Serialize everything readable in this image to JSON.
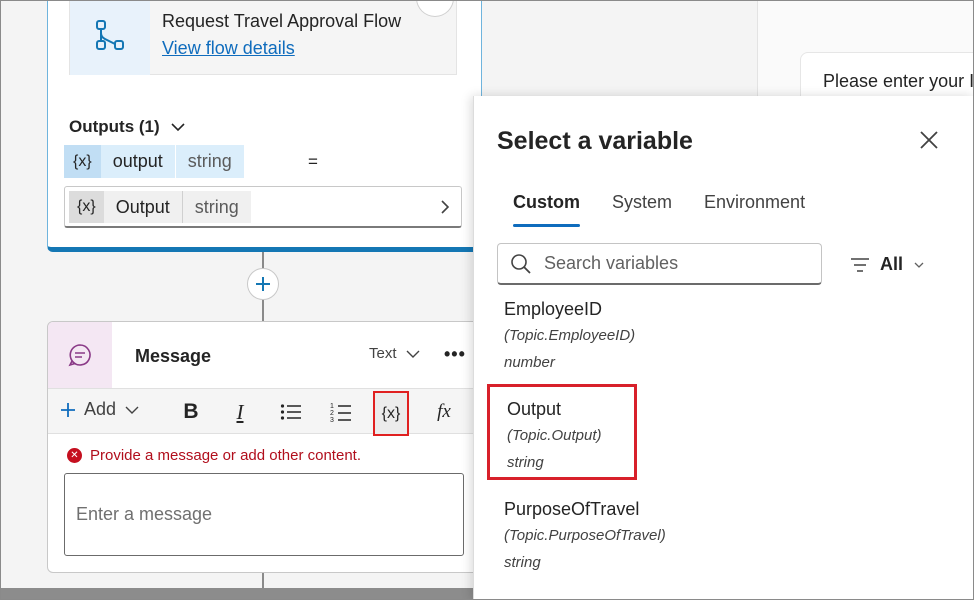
{
  "flow": {
    "title": "Request Travel Approval Flow",
    "link": "View flow details",
    "outputs_label": "Outputs (1)",
    "output_var": {
      "icon": "{x}",
      "name": "output",
      "type": "string"
    },
    "equals": "=",
    "assigned_var": {
      "icon": "{x}",
      "name": "Output",
      "type": "string"
    }
  },
  "message": {
    "title": "Message",
    "type_label": "Text",
    "more": "•••",
    "toolbar": {
      "add_label": "Add",
      "bold": "B",
      "italic": "I",
      "variable": "{x}",
      "formula": "fx"
    },
    "error": "Provide a message or add other content.",
    "placeholder": "Enter a message"
  },
  "chat": {
    "bubble_text": "Please enter your I"
  },
  "panel": {
    "title": "Select a variable",
    "tabs": [
      "Custom",
      "System",
      "Environment"
    ],
    "active_tab": "Custom",
    "search_placeholder": "Search variables",
    "filter_label": "All",
    "variables": [
      {
        "name": "EmployeeID",
        "path": "(Topic.EmployeeID)",
        "type": "number"
      },
      {
        "name": "Output",
        "path": "(Topic.Output)",
        "type": "string"
      },
      {
        "name": "PurposeOfTravel",
        "path": "(Topic.PurposeOfTravel)",
        "type": "string"
      }
    ]
  },
  "colors": {
    "accent": "#0f6cbd",
    "flow_border": "#1477b4",
    "error": "#c50f1f",
    "highlight": "#d8202a"
  }
}
